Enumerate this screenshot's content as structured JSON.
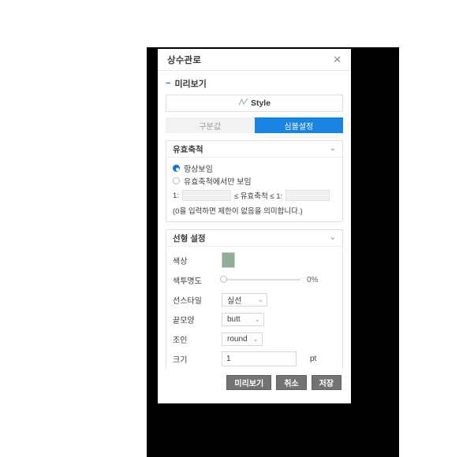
{
  "dialog": {
    "title": "상수관로",
    "close_icon": "close-icon"
  },
  "preview": {
    "section_label": "미리보기",
    "toggle_symbol": "−",
    "style_label": "Style",
    "style_icon": "zigzag-line-icon",
    "line_color": "#9bb3a0"
  },
  "tabs": [
    {
      "label": "구분값",
      "active": false
    },
    {
      "label": "심볼설정",
      "active": true
    }
  ],
  "scale_panel": {
    "title": "유효축척",
    "chevron": "⌄",
    "options": [
      {
        "label": "항상보임",
        "selected": true
      },
      {
        "label": "유효축척에서만 보임",
        "selected": false
      }
    ],
    "min_prefix": "1:",
    "min_value": "",
    "middle_text": "≤ 유효축척 ≤ 1:",
    "max_value": "",
    "note": "(0을 입력하면 제한이 없음을 의미합니다.)"
  },
  "line_panel": {
    "title": "선형 설정",
    "chevron": "⌄",
    "color_label": "색상",
    "color_value": "#8fae96",
    "opacity_label": "색투명도",
    "opacity_value": "0%",
    "opacity_percent": 0,
    "linestyle_label": "선스타일",
    "linestyle_value": "실선",
    "cap_label": "끝모양",
    "cap_value": "butt",
    "join_label": "조인",
    "join_value": "round",
    "size_label": "크기",
    "size_value": "1",
    "size_unit": "pt"
  },
  "footer": {
    "preview_button": "미리보기",
    "cancel_button": "취소",
    "save_button": "저장"
  },
  "colors": {
    "accent_blue": "#1a84e2",
    "radio_blue": "#1a6fd4",
    "button_gray": "#737373"
  }
}
